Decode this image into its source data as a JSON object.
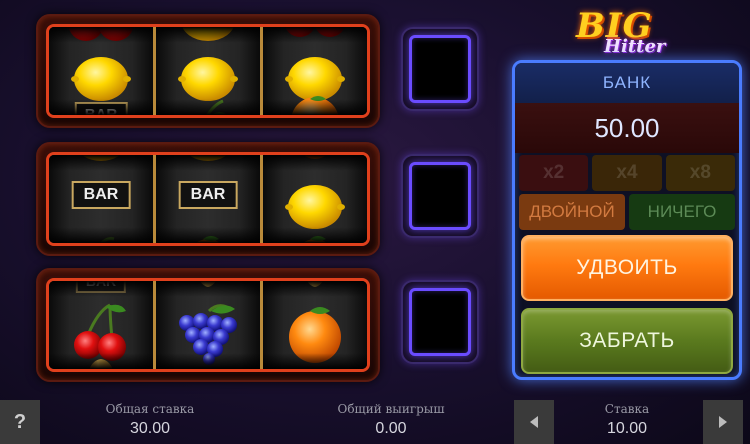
{
  "logo": {
    "word1": "BIG",
    "word2": "Hitter"
  },
  "reels": [
    {
      "reel1": [
        "cherry",
        "lemon",
        "bar"
      ],
      "reel2": [
        "lemon",
        "lemon",
        "cherry"
      ],
      "reel3": [
        "cherry",
        "lemon",
        "orange"
      ]
    },
    {
      "reel1": [
        "lemon",
        "bar",
        "grapes"
      ],
      "reel2": [
        "lemon",
        "bar",
        "orange"
      ],
      "reel3": [
        "orange",
        "lemon",
        "orange"
      ]
    },
    {
      "reel1": [
        "bar",
        "cherry",
        "bell"
      ],
      "reel2": [
        "bell",
        "grapes",
        "lemon"
      ],
      "reel3": [
        "bell",
        "orange",
        "lemon"
      ]
    }
  ],
  "bar_symbol_text": "BAR",
  "gamble": {
    "bank_label": "БАНК",
    "bank_value": "50.00",
    "multipliers": [
      "x2",
      "x4",
      "x8"
    ],
    "double_choice": "ДВОЙНОЙ",
    "nothing_choice": "НИЧЕГО",
    "double_button": "УДВОИТЬ",
    "take_button": "ЗАБРАТЬ"
  },
  "bottom": {
    "help_label": "?",
    "total_bet_label": "Общая ставка",
    "total_bet_value": "30.00",
    "total_win_label": "Общий выигрыш",
    "total_win_value": "0.00",
    "bet_label": "Ставка",
    "bet_value": "10.00"
  },
  "colors": {
    "reel_frame": "#e0401c",
    "panel_border": "#4a7cff",
    "double_button": "#ff7a10",
    "take_button": "#5a7a1e"
  }
}
